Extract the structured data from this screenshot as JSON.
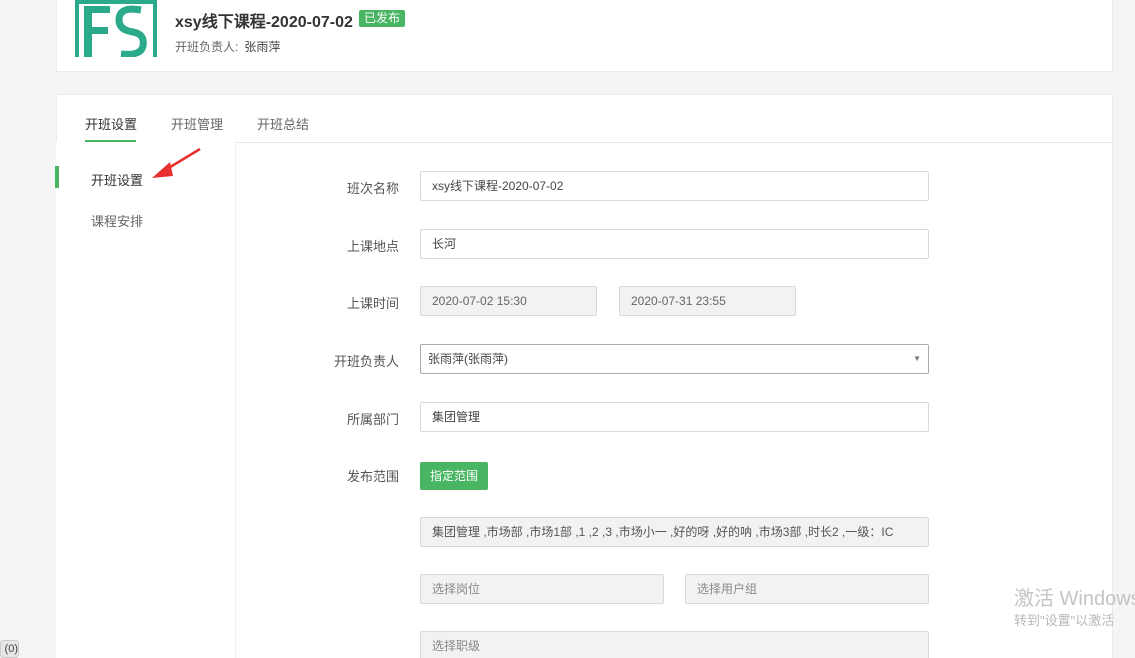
{
  "header": {
    "course_title": "xsy线下课程-2020-07-02",
    "status_badge": "已发布",
    "owner_label": "开班负责人:",
    "owner_name": "张雨萍"
  },
  "tabs": [
    {
      "label": "开班设置",
      "active": true
    },
    {
      "label": "开班管理",
      "active": false
    },
    {
      "label": "开班总结",
      "active": false
    }
  ],
  "sidebar": {
    "items": [
      {
        "label": "开班设置",
        "active": true
      },
      {
        "label": "课程安排",
        "active": false
      }
    ]
  },
  "form": {
    "class_name": {
      "label": "班次名称",
      "value": "xsy线下课程-2020-07-02"
    },
    "location": {
      "label": "上课地点",
      "value": "长河"
    },
    "time": {
      "label": "上课时间",
      "start": "2020-07-02 15:30",
      "end": "2020-07-31 23:55"
    },
    "owner": {
      "label": "开班负责人",
      "value": "张雨萍(张雨萍)"
    },
    "department": {
      "label": "所属部门",
      "value": "集团管理"
    },
    "scope": {
      "label": "发布范围",
      "button_label": "指定范围",
      "selected_departments": "集团管理 ,市场部 ,市场1部 ,1 ,2 ,3 ,市场小一 ,好的呀 ,好的呐 ,市场3部 ,时长2 ,一级：IC",
      "position_placeholder": "选择岗位",
      "user_group_placeholder": "选择用户组",
      "rank_placeholder": "选择职级"
    }
  },
  "watermark": {
    "title": "激活 Windows",
    "subtitle": "转到\"设置\"以激活"
  },
  "corner_tag": "(0)",
  "colors": {
    "accent": "#47b562",
    "arrow": "#e8302f"
  }
}
